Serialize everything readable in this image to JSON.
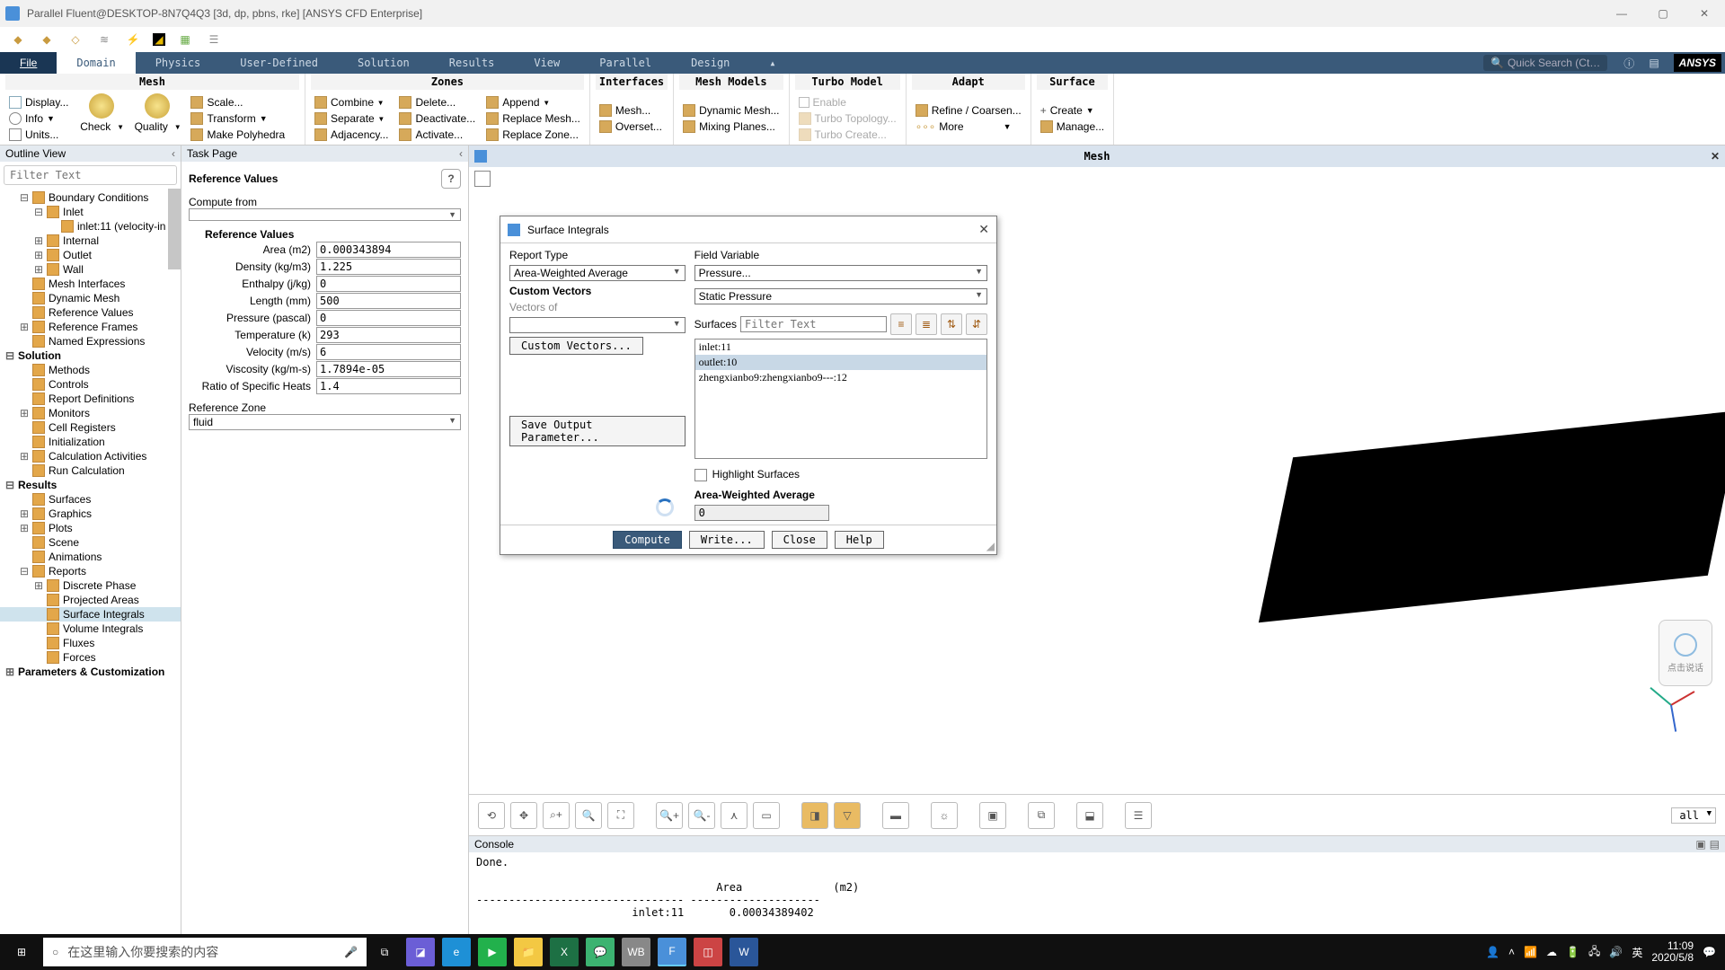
{
  "window": {
    "title": "Parallel Fluent@DESKTOP-8N7Q4Q3  [3d, dp, pbns, rke] [ANSYS CFD Enterprise]"
  },
  "menubar": {
    "file": "File",
    "tabs": [
      "Domain",
      "Physics",
      "User-Defined",
      "Solution",
      "Results",
      "View",
      "Parallel",
      "Design"
    ],
    "active": "Domain",
    "search_placeholder": "Quick Search (Ct…",
    "logo": "ANSYS"
  },
  "ribbon": {
    "mesh": {
      "label": "Mesh",
      "left": [
        "Display...",
        "Info",
        "Units..."
      ],
      "check": "Check",
      "quality": "Quality",
      "right": [
        "Scale...",
        "Transform",
        "Make Polyhedra"
      ]
    },
    "zones": {
      "label": "Zones",
      "c1": [
        "Combine",
        "Separate",
        "Adjacency..."
      ],
      "c2": [
        "Delete...",
        "Deactivate...",
        "Activate..."
      ],
      "c3": [
        "Append",
        "Replace Mesh...",
        "Replace Zone..."
      ]
    },
    "interfaces": {
      "label": "Interfaces",
      "items": [
        "Mesh...",
        "Overset..."
      ]
    },
    "meshmodels": {
      "label": "Mesh Models",
      "items": [
        "Dynamic Mesh...",
        "Mixing Planes..."
      ]
    },
    "turbo": {
      "label": "Turbo Model",
      "items": [
        "Enable",
        "Turbo Topology...",
        "Turbo Create..."
      ]
    },
    "adapt": {
      "label": "Adapt",
      "items": [
        "Refine / Coarsen...",
        "More"
      ]
    },
    "surface": {
      "label": "Surface",
      "items": [
        "Create",
        "Manage..."
      ]
    }
  },
  "outline": {
    "title": "Outline View",
    "filter_placeholder": "Filter Text",
    "items": [
      {
        "t": "Boundary Conditions",
        "lvl": 1,
        "exp": "−",
        "bold": false,
        "ic": "bc"
      },
      {
        "t": "Inlet",
        "lvl": 2,
        "exp": "−",
        "ic": "bc"
      },
      {
        "t": "inlet:11 (velocity-in",
        "lvl": 3,
        "ic": "inlet"
      },
      {
        "t": "Internal",
        "lvl": 2,
        "exp": "+",
        "ic": "bc"
      },
      {
        "t": "Outlet",
        "lvl": 2,
        "exp": "+",
        "ic": "bc"
      },
      {
        "t": "Wall",
        "lvl": 2,
        "exp": "+",
        "ic": "bc"
      },
      {
        "t": "Mesh Interfaces",
        "lvl": 1,
        "ic": "mi"
      },
      {
        "t": "Dynamic Mesh",
        "lvl": 1,
        "ic": "dm"
      },
      {
        "t": "Reference Values",
        "lvl": 1,
        "ic": "rv"
      },
      {
        "t": "Reference Frames",
        "lvl": 1,
        "exp": "+",
        "ic": "rf"
      },
      {
        "t": "Named Expressions",
        "lvl": 1,
        "ic": "ne"
      },
      {
        "t": "Solution",
        "lvl": 0,
        "exp": "−",
        "bold": true
      },
      {
        "t": "Methods",
        "lvl": 1,
        "ic": "m"
      },
      {
        "t": "Controls",
        "lvl": 1,
        "ic": "c"
      },
      {
        "t": "Report Definitions",
        "lvl": 1,
        "ic": "rd"
      },
      {
        "t": "Monitors",
        "lvl": 1,
        "exp": "+",
        "ic": "mo"
      },
      {
        "t": "Cell Registers",
        "lvl": 1,
        "ic": "cr"
      },
      {
        "t": "Initialization",
        "lvl": 1,
        "ic": "in"
      },
      {
        "t": "Calculation Activities",
        "lvl": 1,
        "exp": "+",
        "ic": "ca"
      },
      {
        "t": "Run Calculation",
        "lvl": 1,
        "ic": "rc"
      },
      {
        "t": "Results",
        "lvl": 0,
        "exp": "−",
        "bold": true
      },
      {
        "t": "Surfaces",
        "lvl": 1,
        "ic": "su"
      },
      {
        "t": "Graphics",
        "lvl": 1,
        "exp": "+",
        "ic": "gr"
      },
      {
        "t": "Plots",
        "lvl": 1,
        "exp": "+",
        "ic": "pl"
      },
      {
        "t": "Scene",
        "lvl": 1,
        "ic": "sc"
      },
      {
        "t": "Animations",
        "lvl": 1,
        "ic": "an"
      },
      {
        "t": "Reports",
        "lvl": 1,
        "exp": "−",
        "ic": "rp"
      },
      {
        "t": "Discrete Phase",
        "lvl": 2,
        "exp": "+",
        "ic": "dp"
      },
      {
        "t": "Projected Areas",
        "lvl": 2,
        "ic": "pa"
      },
      {
        "t": "Surface Integrals",
        "lvl": 2,
        "ic": "si",
        "sel": true
      },
      {
        "t": "Volume Integrals",
        "lvl": 2,
        "ic": "vi"
      },
      {
        "t": "Fluxes",
        "lvl": 2,
        "ic": "fl"
      },
      {
        "t": "Forces",
        "lvl": 2,
        "ic": "fo"
      },
      {
        "t": "Parameters & Customization",
        "lvl": 0,
        "exp": "+",
        "bold": true
      }
    ]
  },
  "taskpage": {
    "title": "Task Page",
    "heading": "Reference Values",
    "compute_from": "Compute from",
    "compute_from_value": "",
    "subhead": "Reference Values",
    "rows": [
      {
        "l": "Area (m2)",
        "v": "0.000343894"
      },
      {
        "l": "Density (kg/m3)",
        "v": "1.225"
      },
      {
        "l": "Enthalpy (j/kg)",
        "v": "0"
      },
      {
        "l": "Length (mm)",
        "v": "500"
      },
      {
        "l": "Pressure (pascal)",
        "v": "0"
      },
      {
        "l": "Temperature (k)",
        "v": "293"
      },
      {
        "l": "Velocity (m/s)",
        "v": "6"
      },
      {
        "l": "Viscosity (kg/m-s)",
        "v": "1.7894e-05"
      },
      {
        "l": "Ratio of Specific Heats",
        "v": "1.4"
      }
    ],
    "refzone_label": "Reference Zone",
    "refzone_value": "fluid"
  },
  "viewport": {
    "tab": "Mesh",
    "all": "all",
    "console_title": "Console",
    "console_lines": "Done.\n\n                                     Area              (m2)\n-------------------------------- --------------------\n                        inlet:11       0.00034389402"
  },
  "dialog": {
    "title": "Surface Integrals",
    "report_type_label": "Report Type",
    "report_type": "Area-Weighted Average",
    "custom_vectors_label": "Custom Vectors",
    "vectors_of": "Vectors of",
    "custom_vectors_btn": "Custom Vectors...",
    "save_output": "Save Output Parameter...",
    "field_var_label": "Field Variable",
    "field_var": "Pressure...",
    "field_sub": "Static Pressure",
    "surfaces_label": "Surfaces",
    "filter_placeholder": "Filter Text",
    "surfaces": [
      {
        "n": "inlet:11",
        "sel": false
      },
      {
        "n": "outlet:10",
        "sel": true
      },
      {
        "n": "zhengxianbo9:zhengxianbo9---:12",
        "sel": false
      }
    ],
    "highlight": "Highlight Surfaces",
    "result_label": "Area-Weighted Average",
    "result_value": "0",
    "btn_compute": "Compute",
    "btn_write": "Write...",
    "btn_close": "Close",
    "btn_help": "Help"
  },
  "voice": {
    "text": "点击说话"
  },
  "taskbar": {
    "search": "在这里输入你要搜索的内容",
    "ime": "英",
    "time": "11:09",
    "date": "2020/5/8"
  }
}
